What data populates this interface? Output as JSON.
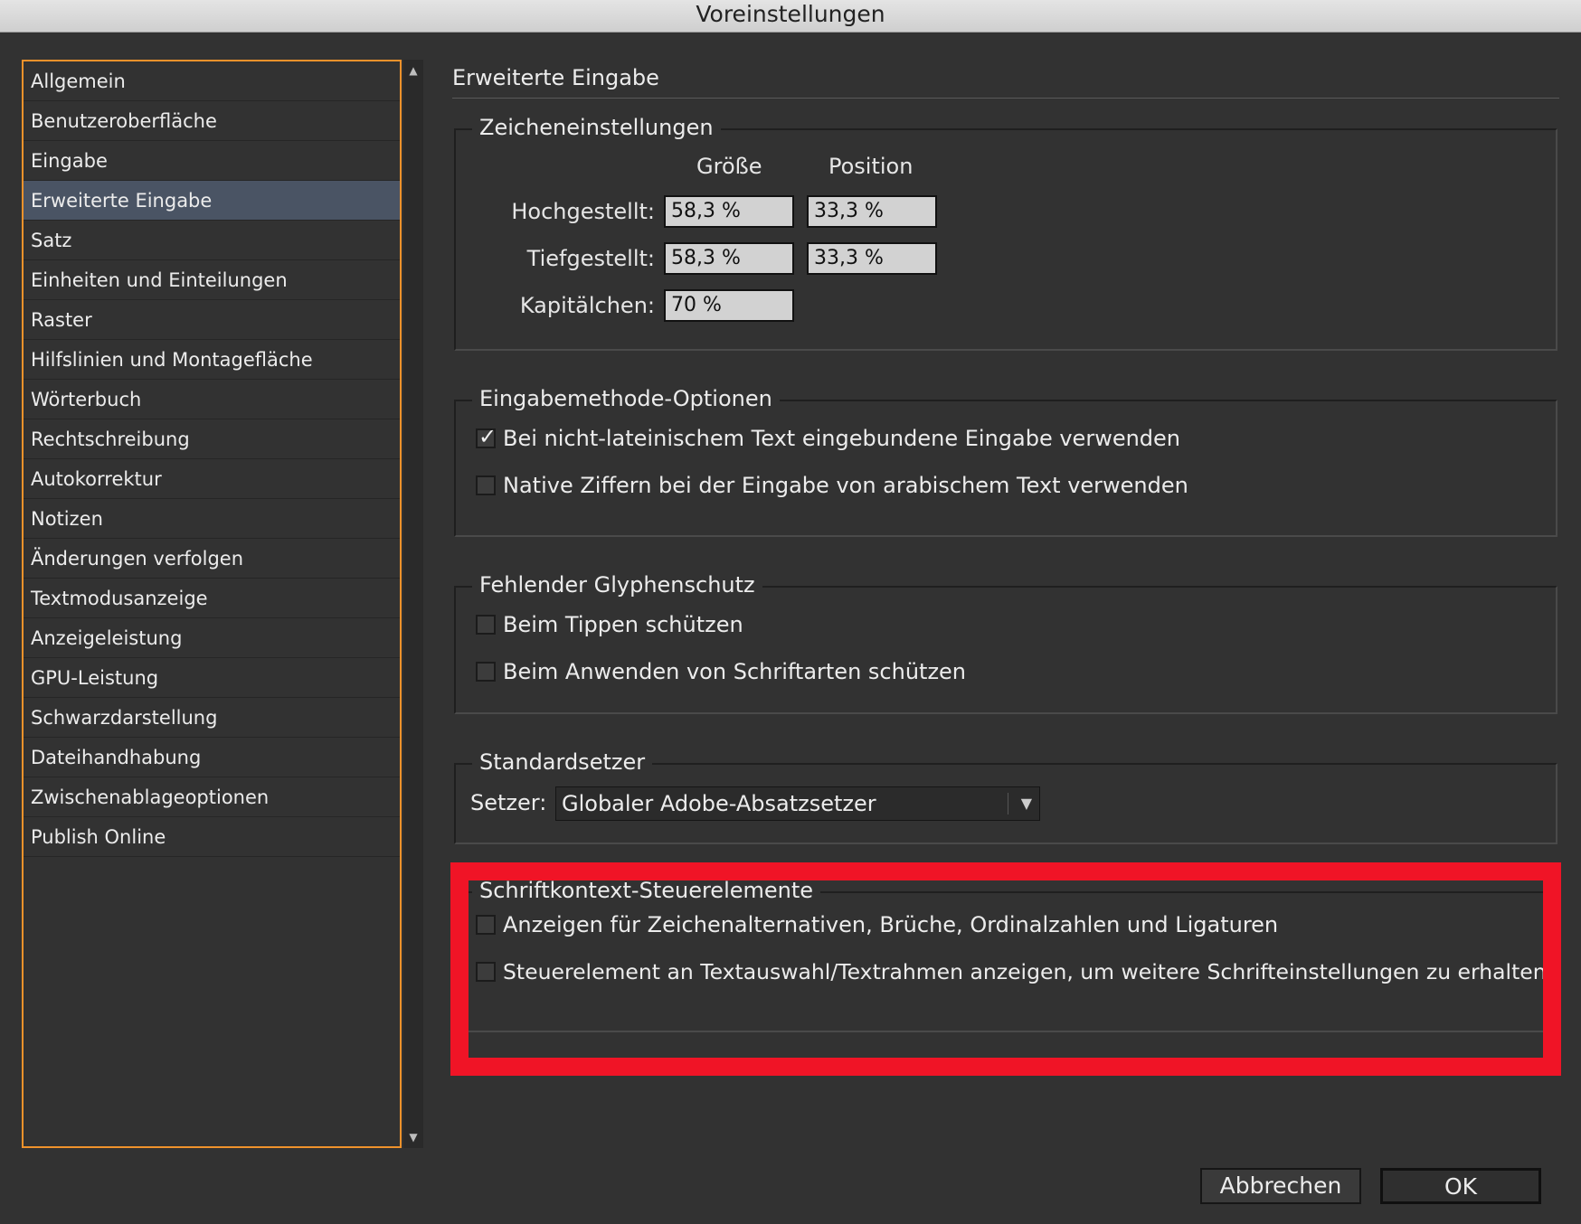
{
  "window": {
    "title": "Voreinstellungen"
  },
  "sidebar": {
    "items": [
      {
        "label": "Allgemein"
      },
      {
        "label": "Benutzeroberfläche"
      },
      {
        "label": "Eingabe"
      },
      {
        "label": "Erweiterte Eingabe",
        "selected": true
      },
      {
        "label": "Satz"
      },
      {
        "label": "Einheiten und Einteilungen"
      },
      {
        "label": "Raster"
      },
      {
        "label": "Hilfslinien und Montagefläche"
      },
      {
        "label": "Wörterbuch"
      },
      {
        "label": "Rechtschreibung"
      },
      {
        "label": "Autokorrektur"
      },
      {
        "label": "Notizen"
      },
      {
        "label": "Änderungen verfolgen"
      },
      {
        "label": "Textmodusanzeige"
      },
      {
        "label": "Anzeigeleistung"
      },
      {
        "label": "GPU-Leistung"
      },
      {
        "label": "Schwarzdarstellung"
      },
      {
        "label": "Dateihandhabung"
      },
      {
        "label": "Zwischenablageoptionen"
      },
      {
        "label": "Publish Online"
      }
    ]
  },
  "panel": {
    "title": "Erweiterte Eingabe",
    "char_settings": {
      "legend": "Zeicheneinstellungen",
      "col_size": "Größe",
      "col_position": "Position",
      "superscript": {
        "label": "Hochgestellt:",
        "size": "58,3 %",
        "position": "33,3 %"
      },
      "subscript": {
        "label": "Tiefgestellt:",
        "size": "58,3 %",
        "position": "33,3 %"
      },
      "small_caps": {
        "label": "Kapitälchen:",
        "size": "70 %"
      }
    },
    "input_method": {
      "legend": "Eingabemethode-Optionen",
      "inline_input": {
        "label": "Bei nicht-lateinischem Text eingebundene Eingabe verwenden",
        "checked": true
      },
      "native_digits": {
        "label": "Native Ziffern bei der Eingabe von arabischem Text verwenden",
        "checked": false
      }
    },
    "glyph_protection": {
      "legend": "Fehlender Glyphenschutz",
      "on_typing": {
        "label": "Beim Tippen schützen",
        "checked": false
      },
      "on_apply_font": {
        "label": "Beim Anwenden von Schriftarten schützen",
        "checked": false
      }
    },
    "composer": {
      "legend": "Standardsetzer",
      "label": "Setzer:",
      "value": "Globaler Adobe-Absatzsetzer"
    },
    "contextual_controls": {
      "legend": "Schriftkontext-Steuerelemente",
      "show_alternates": {
        "label": "Anzeigen für Zeichenalternativen, Brüche, Ordinalzahlen und Ligaturen",
        "checked": false
      },
      "show_selection_control": {
        "label": "Steuerelement an Textauswahl/Textrahmen anzeigen, um weitere Schrifteinstellungen zu erhalten",
        "checked": false
      }
    }
  },
  "footer": {
    "cancel": "Abbrechen",
    "ok": "OK"
  },
  "colors": {
    "highlight": "#f01426",
    "sidebar_border": "#f0922b",
    "selected_item": "#4a5464"
  }
}
